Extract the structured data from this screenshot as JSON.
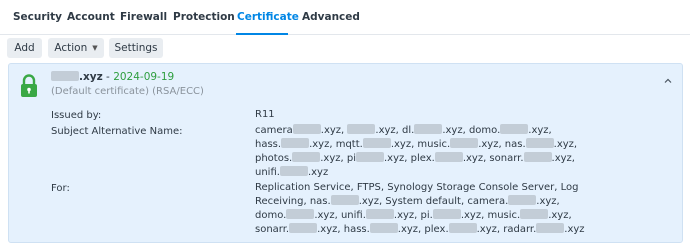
{
  "tabs": [
    {
      "label": "Security"
    },
    {
      "label": "Account"
    },
    {
      "label": "Firewall"
    },
    {
      "label": "Protection"
    },
    {
      "label": "Certificate",
      "active": true
    },
    {
      "label": "Advanced"
    }
  ],
  "toolbar": {
    "add_label": "Add",
    "action_label": "Action",
    "settings_label": "Settings"
  },
  "certificate": {
    "domain": ".xyz",
    "separator": " - ",
    "date": "2024-09-19",
    "subtitle": "(Default certificate) (RSA/ECC)",
    "issued_by_label": "Issued by:",
    "issued_by": "R11",
    "san_label": "Subject Alternative Name:",
    "san_lines": [
      "camera{b}.xyz, {b}.xyz, dl.{b}.xyz, domo.{b}.xyz,",
      "hass.{b}.xyz, mqtt.{b}.xyz, music.{b}.xyz, nas.{b}.xyz,",
      "photos.{b}.xyz, pi{b}.xyz, plex.{b}.xyz, sonarr.{b}.xyz,",
      "unifi.{b}.xyz"
    ],
    "for_label": "For:",
    "for_lines": [
      "Replication Service, FTPS, Synology Storage Console Server, Log",
      "Receiving, nas.{b}.xyz, System default, camera.{b}.xyz,",
      "domo.{b}.xyz, unifi.{b}.xyz, pi.{b}.xyz, music.{b}.xyz,",
      "sonarr.{b}.xyz, hass.{b}.xyz, plex.{b}.xyz, radarr.{b}.xyz"
    ]
  },
  "colors": {
    "accent": "#0086e5",
    "date_green": "#2e9e3f",
    "card_bg": "#e5f1fd",
    "lock_green": "#3aa845",
    "redaction": "#c3cdd7"
  },
  "icons": {
    "lock": "lock-icon",
    "chevron": "chevron-up-icon",
    "caret": "caret-down-icon"
  }
}
